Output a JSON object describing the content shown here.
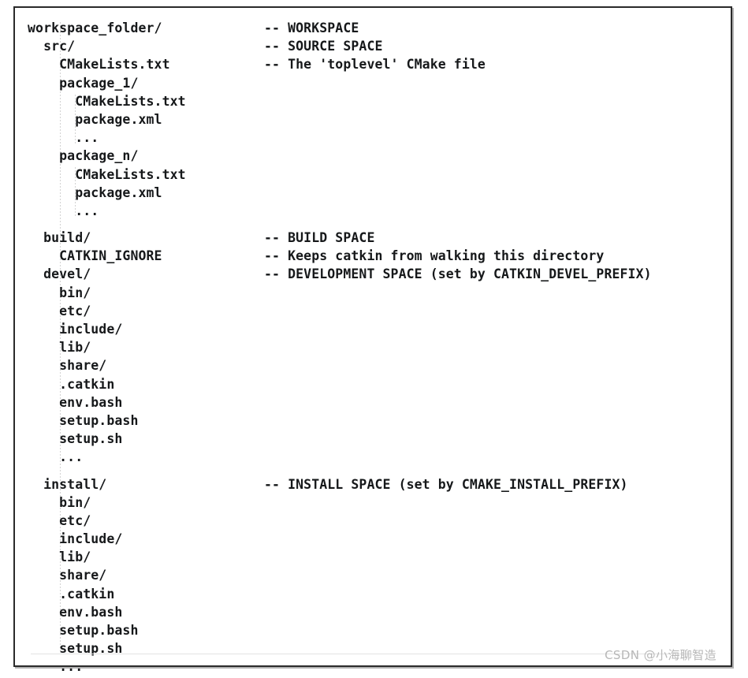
{
  "figure": {
    "kind": "catkin-workspace-directory-tree",
    "watermark": "CSDN @小海聊智造",
    "comment_marker": "--",
    "colors": {
      "text": "#16181a",
      "border": "#2a2a2a",
      "background": "#ffffff",
      "guide": "#d2d2d2",
      "watermark": "#b7b7b7"
    }
  },
  "tree": {
    "rows": [
      {
        "path": "workspace_folder/",
        "comment": "-- WORKSPACE"
      },
      {
        "path": "  src/",
        "comment": "-- SOURCE SPACE"
      },
      {
        "path": "    CMakeLists.txt",
        "comment": "-- The 'toplevel' CMake file"
      },
      {
        "path": "    package_1/",
        "comment": ""
      },
      {
        "path": "      CMakeLists.txt",
        "comment": ""
      },
      {
        "path": "      package.xml",
        "comment": ""
      },
      {
        "path": "      ...",
        "comment": ""
      },
      {
        "path": "    package_n/",
        "comment": ""
      },
      {
        "path": "      CMakeLists.txt",
        "comment": ""
      },
      {
        "path": "      package.xml",
        "comment": ""
      },
      {
        "path": "      ...",
        "comment": ""
      },
      {
        "path": "  build/",
        "comment": "-- BUILD SPACE"
      },
      {
        "path": "    CATKIN_IGNORE",
        "comment": "-- Keeps catkin from walking this directory"
      },
      {
        "path": "  devel/",
        "comment": "-- DEVELOPMENT SPACE (set by CATKIN_DEVEL_PREFIX)"
      },
      {
        "path": "    bin/",
        "comment": ""
      },
      {
        "path": "    etc/",
        "comment": ""
      },
      {
        "path": "    include/",
        "comment": ""
      },
      {
        "path": "    lib/",
        "comment": ""
      },
      {
        "path": "    share/",
        "comment": ""
      },
      {
        "path": "    .catkin",
        "comment": ""
      },
      {
        "path": "    env.bash",
        "comment": ""
      },
      {
        "path": "    setup.bash",
        "comment": ""
      },
      {
        "path": "    setup.sh",
        "comment": ""
      },
      {
        "path": "    ...",
        "comment": ""
      },
      {
        "path": "  install/",
        "comment": "-- INSTALL SPACE (set by CMAKE_INSTALL_PREFIX)"
      },
      {
        "path": "    bin/",
        "comment": ""
      },
      {
        "path": "    etc/",
        "comment": ""
      },
      {
        "path": "    include/",
        "comment": ""
      },
      {
        "path": "    lib/",
        "comment": ""
      },
      {
        "path": "    share/",
        "comment": ""
      },
      {
        "path": "    .catkin",
        "comment": ""
      },
      {
        "path": "    env.bash",
        "comment": ""
      },
      {
        "path": "    setup.bash",
        "comment": ""
      },
      {
        "path": "    setup.sh",
        "comment": ""
      },
      {
        "path": "    ...",
        "comment": ""
      }
    ]
  }
}
